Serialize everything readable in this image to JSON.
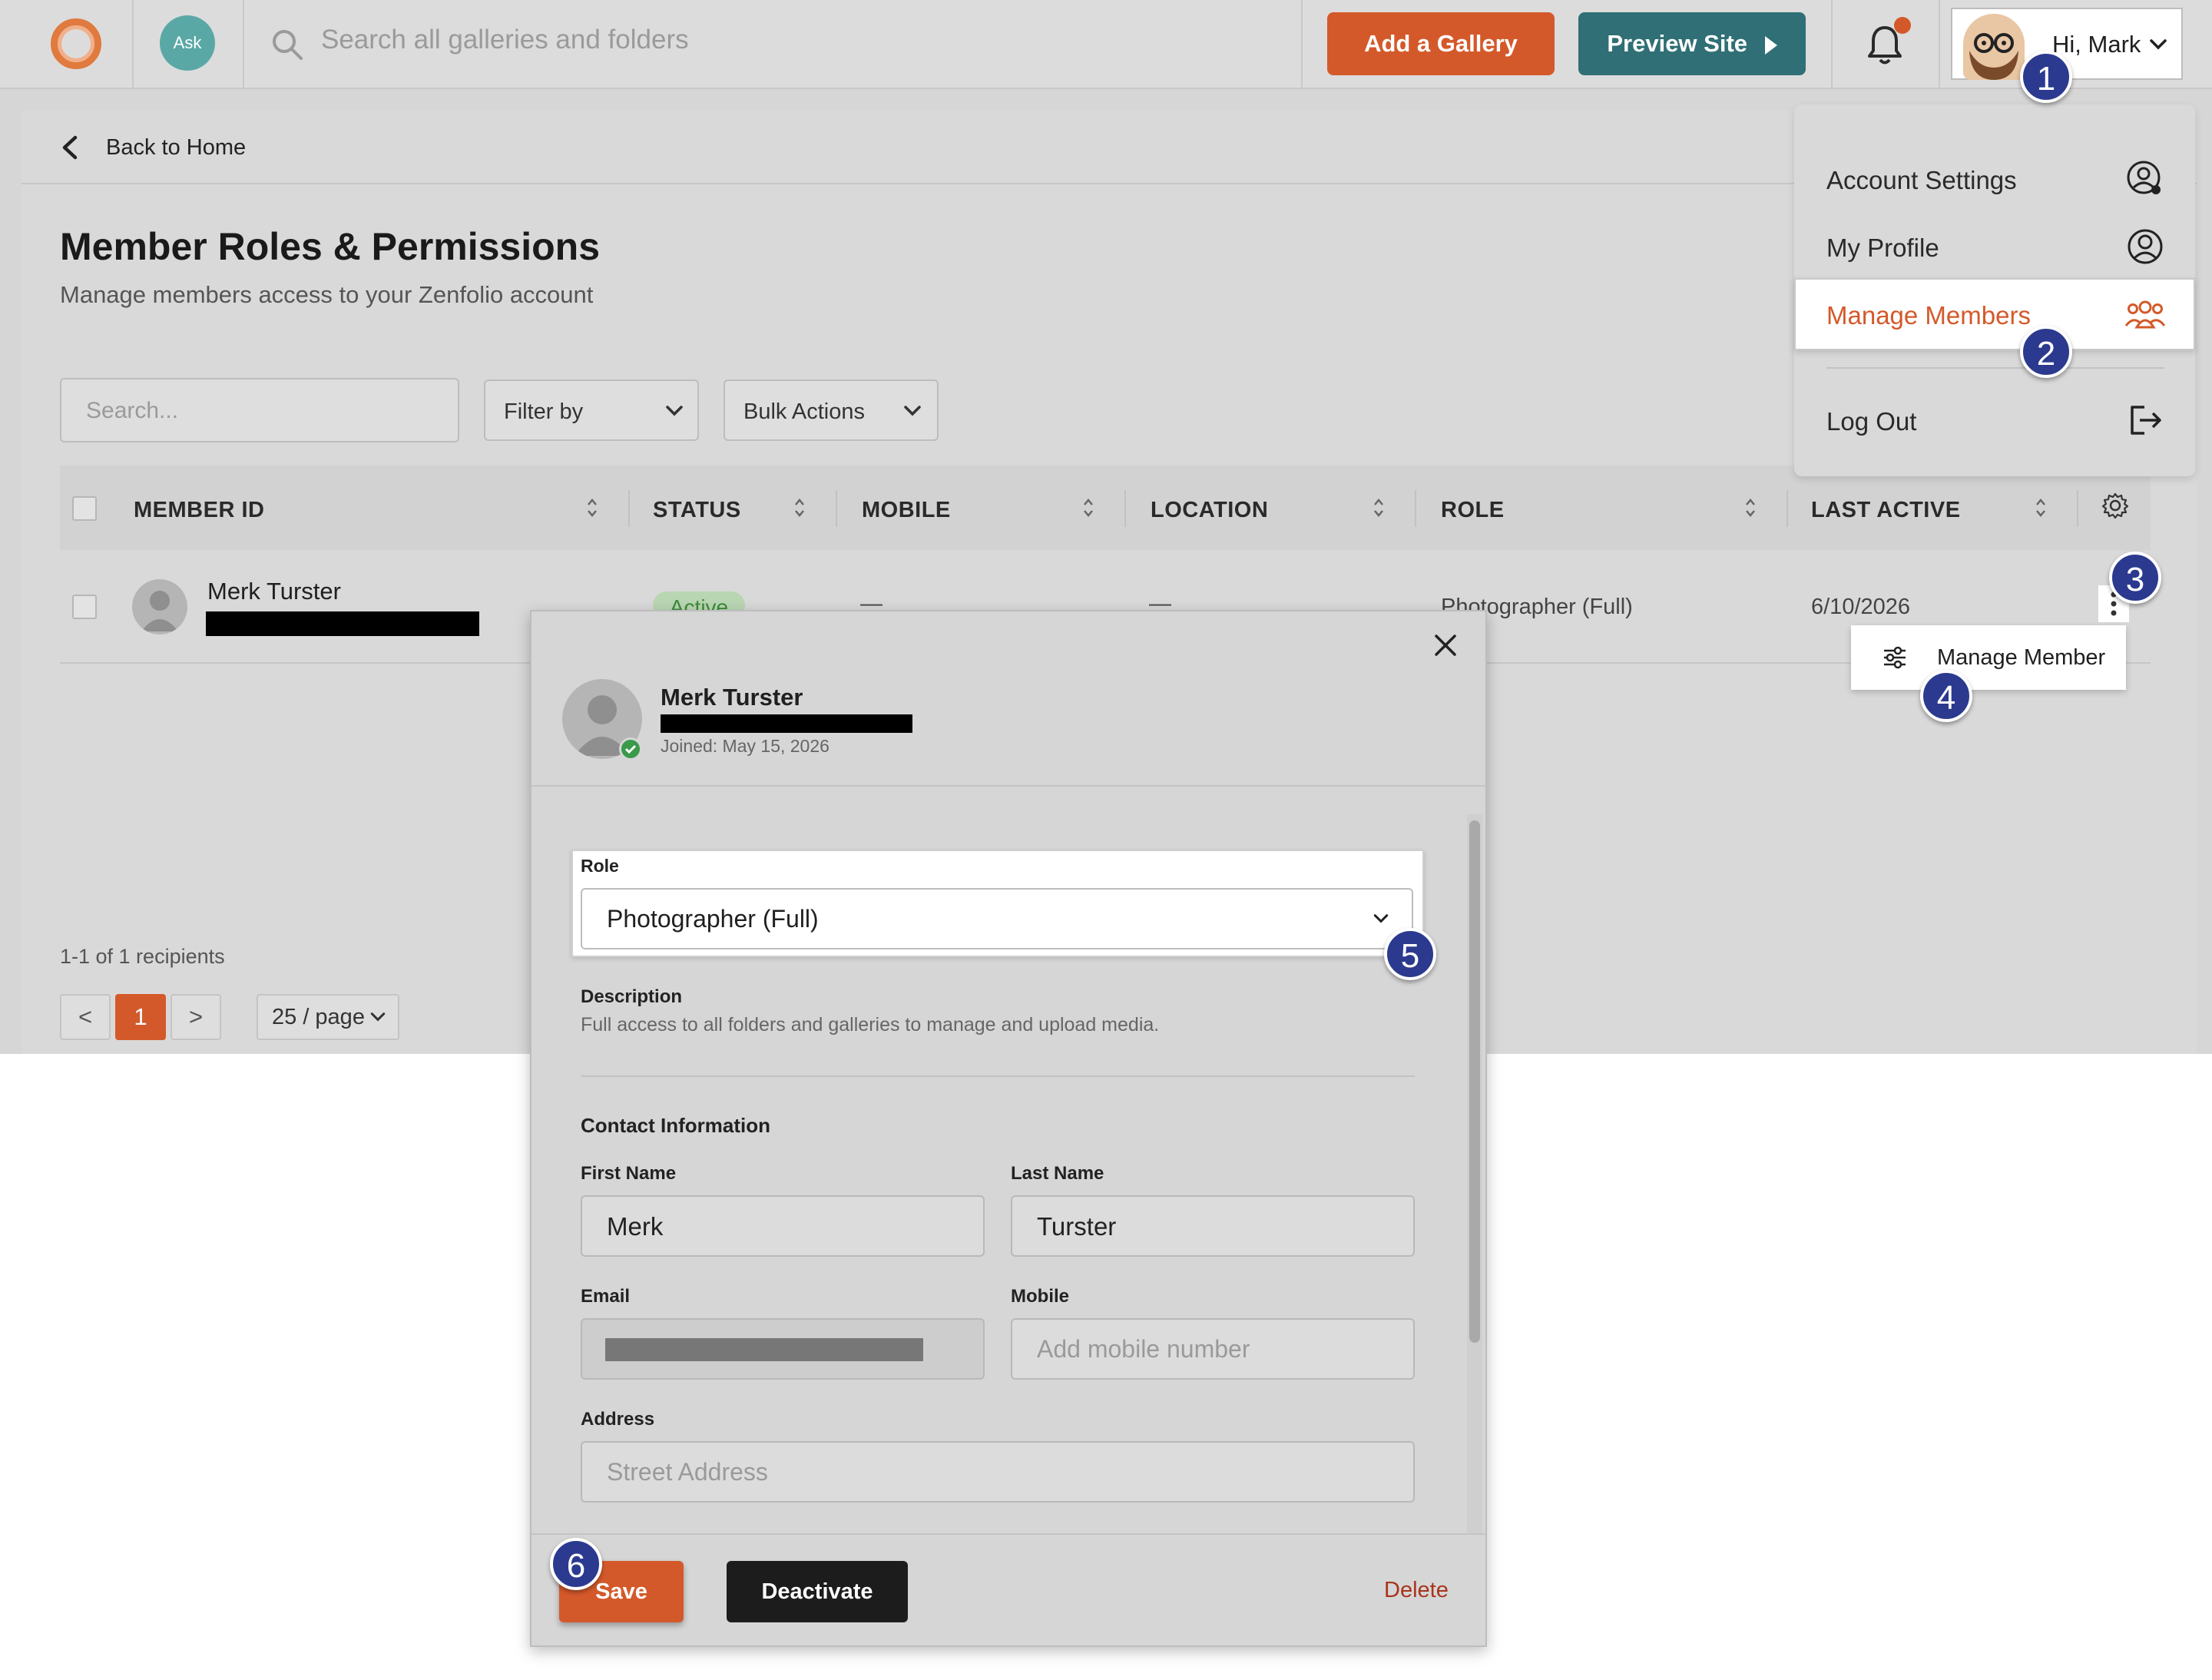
{
  "topbar": {
    "search_placeholder": "Search all galleries and folders",
    "add_gallery": "Add a Gallery",
    "preview_site": "Preview Site",
    "greeting": "Hi, Mark",
    "ask_label": "Ask"
  },
  "back_label": "Back to Home",
  "page": {
    "title": "Member Roles & Permissions",
    "subtitle": "Manage members access to your Zenfolio account"
  },
  "toolbar": {
    "search_placeholder": "Search...",
    "filter": "Filter by",
    "bulk": "Bulk Actions"
  },
  "table": {
    "headers": [
      "MEMBER ID",
      "STATUS",
      "MOBILE",
      "LOCATION",
      "ROLE",
      "LAST ACTIVE"
    ],
    "row": {
      "name": "Merk Turster",
      "status": "Active",
      "mobile": "—",
      "location": "—",
      "role": "Photographer (Full)",
      "last_active": "6/10/2026"
    }
  },
  "pagination": {
    "summary": "1-1 of 1 recipients",
    "prev": "<",
    "current": "1",
    "next": ">",
    "per_page": "25 / page"
  },
  "user_menu": {
    "items": [
      "Account Settings",
      "My Profile",
      "Manage Members",
      "Log Out"
    ]
  },
  "row_popover": {
    "label": "Manage Member"
  },
  "modal": {
    "name": "Merk Turster",
    "joined": "Joined: May 15, 2026",
    "role_label": "Role",
    "role_value": "Photographer (Full)",
    "description_label": "Description",
    "description": "Full access to all folders and galleries to manage and upload media.",
    "contact_heading": "Contact Information",
    "first_name_label": "First Name",
    "first_name": "Merk",
    "last_name_label": "Last Name",
    "last_name": "Turster",
    "email_label": "Email",
    "mobile_label": "Mobile",
    "mobile_placeholder": "Add mobile number",
    "address_label": "Address",
    "address_placeholder": "Street Address",
    "save": "Save",
    "deactivate": "Deactivate",
    "delete": "Delete"
  },
  "badges": [
    "1",
    "2",
    "3",
    "4",
    "5",
    "6"
  ],
  "colors": {
    "accent_orange": "#d4592a",
    "teal": "#2f6f75",
    "badge_blue": "#2b3a8f",
    "status_green": "#3d8a3a"
  }
}
